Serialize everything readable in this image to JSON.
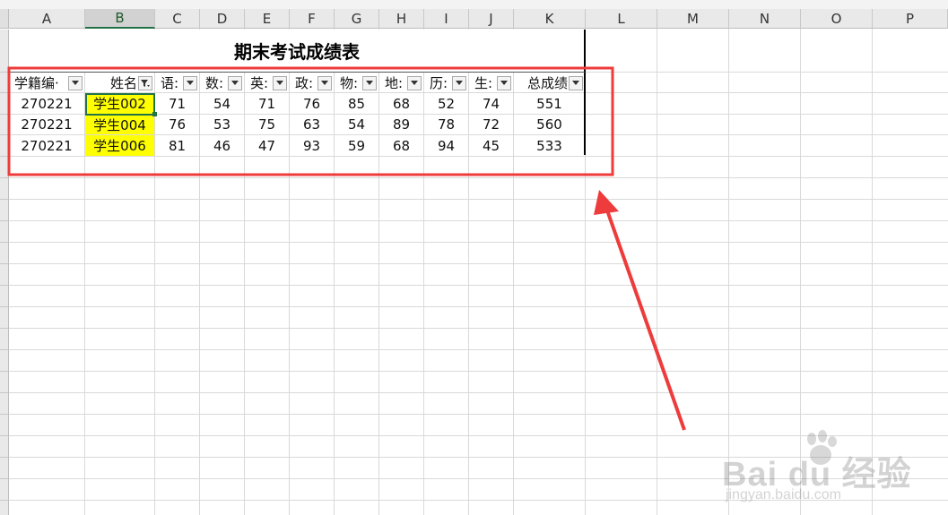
{
  "sheet": {
    "columns": [
      "A",
      "B",
      "C",
      "D",
      "E",
      "F",
      "G",
      "H",
      "I",
      "J",
      "K",
      "L",
      "M",
      "N",
      "O",
      "P"
    ],
    "selected_column": "B",
    "title": "期末考试成绩表",
    "headers": [
      "学籍编·",
      "姓名",
      "语:",
      "数:",
      "英:",
      "政:",
      "物:",
      "地:",
      "历:",
      "生:",
      "总成绩"
    ],
    "rows": [
      [
        "270221",
        "学生002",
        "71",
        "54",
        "71",
        "76",
        "85",
        "68",
        "52",
        "74",
        "551"
      ],
      [
        "270221",
        "学生004",
        "76",
        "53",
        "75",
        "63",
        "54",
        "89",
        "78",
        "72",
        "560"
      ],
      [
        "270221",
        "学生006",
        "81",
        "46",
        "47",
        "93",
        "59",
        "68",
        "94",
        "45",
        "533"
      ]
    ],
    "filter_active_icon": "filter-funnel-icon",
    "dropdown_icon": "dropdown-arrow-icon"
  },
  "annotation": {
    "box_color": "#ee3b3b",
    "arrow_color": "#ee3b3b"
  },
  "watermark": {
    "brand": "Bai du 经验",
    "url": "jingyan.baidu.com"
  }
}
